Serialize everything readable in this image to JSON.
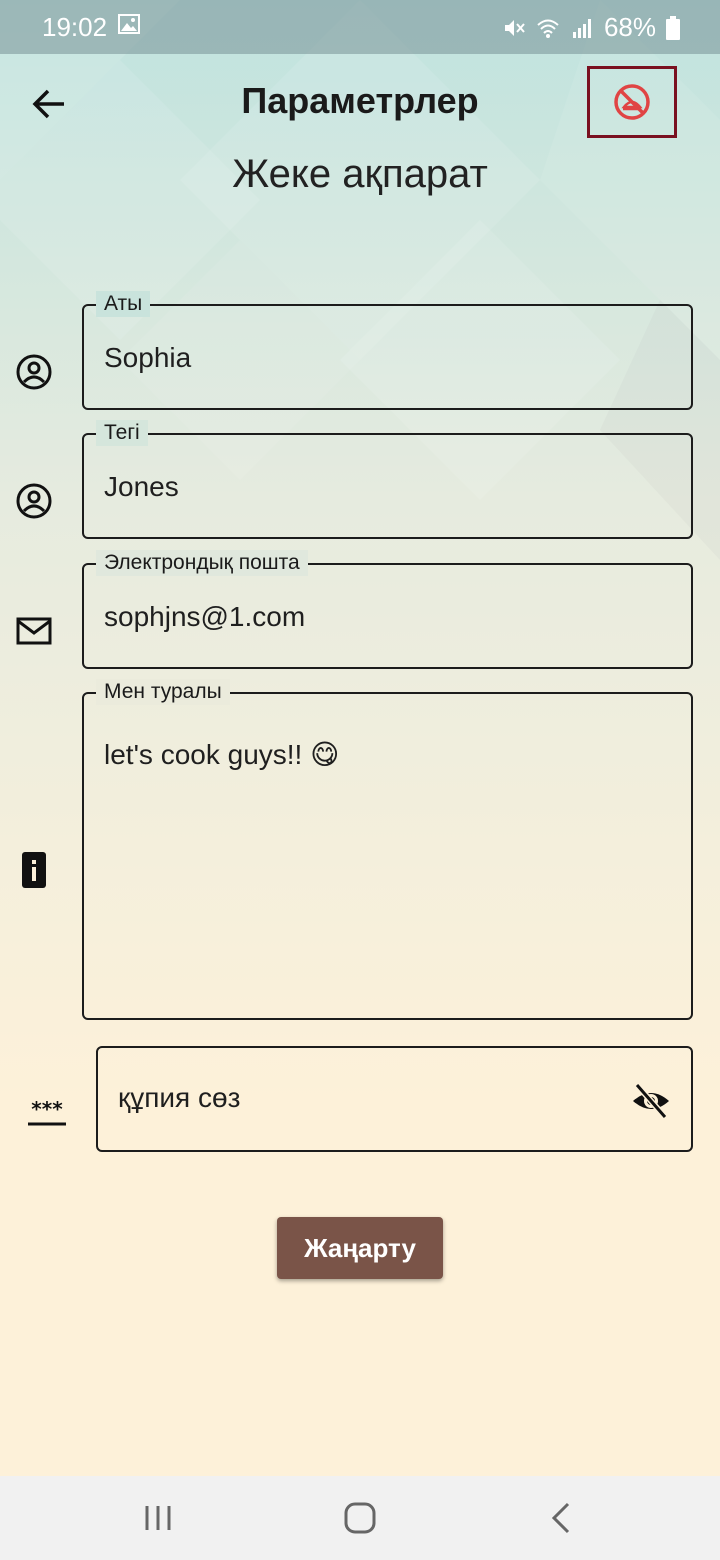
{
  "status_bar": {
    "time": "19:02",
    "battery": "68%",
    "icons": [
      "image-icon",
      "mute-icon",
      "wifi-icon",
      "signal-icon",
      "battery-icon"
    ]
  },
  "app_bar": {
    "title": "Параметрлер",
    "back_icon": "arrow-back-icon",
    "action_icon": "no-food-icon",
    "action_color": "#e04444"
  },
  "section_title": "Жеке ақпарат",
  "form": {
    "first_name": {
      "label": "Аты",
      "value": "Sophia",
      "icon": "account-circle-icon"
    },
    "last_name": {
      "label": "Тегі",
      "value": "Jones",
      "icon": "account-circle-icon"
    },
    "email": {
      "label": "Электрондық пошта",
      "value": "sophjns@1.com",
      "icon": "mail-icon"
    },
    "about": {
      "label": "Мен туралы",
      "value": "let's cook guys!! 😋",
      "icon": "info-icon"
    },
    "password": {
      "placeholder": "құпия сөз",
      "icon": "password-icon",
      "toggle_icon": "visibility-off-icon"
    }
  },
  "update_button": {
    "label": "Жаңарту",
    "color": "#7a5448"
  },
  "nav_bar": {
    "icons": [
      "recents-icon",
      "home-icon",
      "back-icon"
    ]
  }
}
